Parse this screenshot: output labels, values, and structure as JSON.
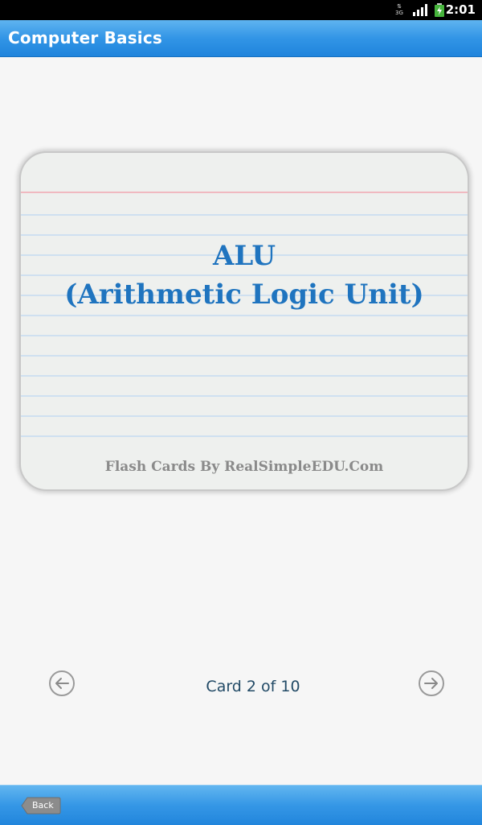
{
  "status_bar": {
    "time": "2:01",
    "network_label": "3G",
    "icons": [
      "network-arrows-icon",
      "signal-icon",
      "battery-charging-icon"
    ]
  },
  "header": {
    "title": "Computer Basics"
  },
  "card": {
    "term_line1": "ALU",
    "term_line2": "(Arithmetic Logic Unit)",
    "credit": "Flash Cards By RealSimpleEDU.Com"
  },
  "navigation": {
    "counter": "Card 2 of 10",
    "prev_icon": "arrow-left-circle-icon",
    "next_icon": "arrow-right-circle-icon"
  },
  "footer": {
    "back_label": "Back"
  },
  "colors": {
    "accent": "#3295e6",
    "term_text": "#1f74bf",
    "counter_text": "#224a66"
  }
}
